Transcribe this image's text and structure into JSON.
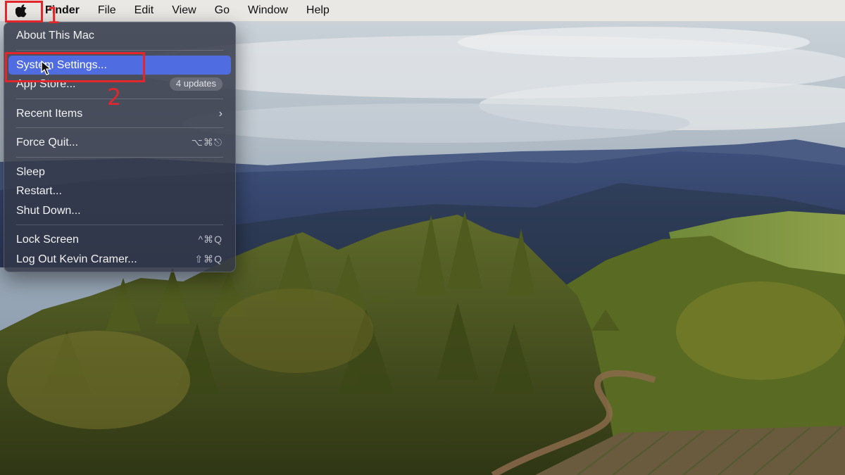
{
  "menubar": {
    "apple_icon": "apple-logo-icon",
    "app_name": "Finder",
    "items": [
      "File",
      "Edit",
      "View",
      "Go",
      "Window",
      "Help"
    ]
  },
  "apple_menu": {
    "about": "About This Mac",
    "system_settings": "System Settings...",
    "app_store": "App Store...",
    "app_store_badge": "4 updates",
    "recent_items": "Recent Items",
    "recent_items_chevron": "›",
    "force_quit": "Force Quit...",
    "force_quit_shortcut": "⌥⌘⎋",
    "sleep": "Sleep",
    "restart": "Restart...",
    "shut_down": "Shut Down...",
    "lock_screen": "Lock Screen",
    "lock_screen_shortcut": "^⌘Q",
    "log_out": "Log Out Kevin Cramer...",
    "log_out_shortcut": "⇧⌘Q"
  },
  "annotations": {
    "step1": "1",
    "step2": "2",
    "color": "#e3262b"
  },
  "colors": {
    "highlight": "#4f6ce0",
    "menu_bg": "#323746"
  }
}
